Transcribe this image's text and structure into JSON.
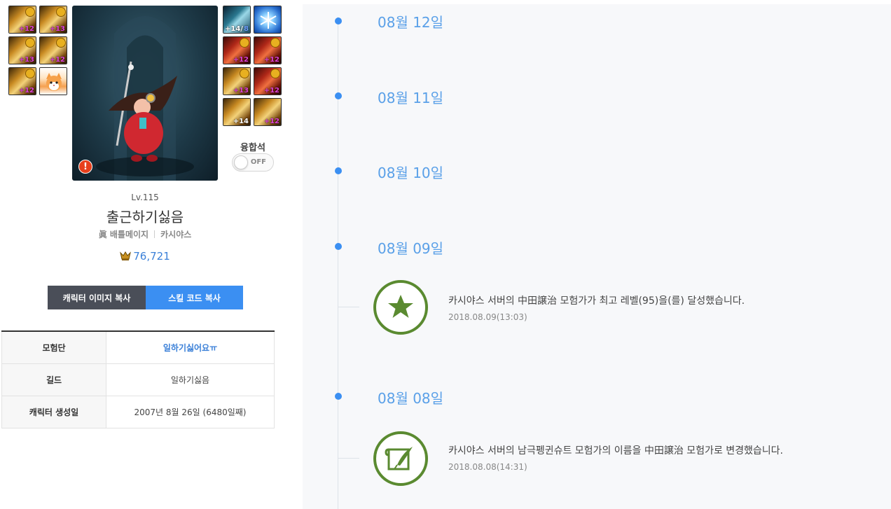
{
  "character": {
    "level": "Lv.115",
    "name": "출근하기싫음",
    "job": "眞 배틀메이지",
    "server": "카시야스",
    "combat_power": "76,721"
  },
  "equipment": {
    "left_slots": [
      {
        "plus": "+12",
        "color": "gold"
      },
      {
        "plus": "+13",
        "color": "gold"
      },
      {
        "plus": "+13",
        "color": "gold"
      },
      {
        "plus": "+12",
        "color": "gold"
      },
      {
        "plus": "+12",
        "color": "gold"
      },
      {
        "plus": "",
        "color": "pet"
      }
    ],
    "right_slots": [
      {
        "plus": "+14/",
        "plus2": "8",
        "color": "teal"
      },
      {
        "plus": "",
        "color": "ice"
      },
      {
        "plus": "+12",
        "color": "red"
      },
      {
        "plus": "+12",
        "color": "red"
      },
      {
        "plus": "+13",
        "color": "gold"
      },
      {
        "plus": "+12",
        "color": "red"
      },
      {
        "plus": "+14",
        "color": "gold"
      },
      {
        "plus": "+12",
        "color": "gold"
      }
    ]
  },
  "fusion": {
    "label": "융합석",
    "state": "OFF"
  },
  "warning_icon": "!",
  "buttons": {
    "copy_image": "캐릭터 이미지 복사",
    "copy_skill": "스킬 코드 복사"
  },
  "info_table": [
    {
      "key": "모험단",
      "value": "일하기싫어요ㅠ",
      "link": true
    },
    {
      "key": "길드",
      "value": "일하기싫음",
      "link": false
    },
    {
      "key": "캐릭터 생성일",
      "value": "2007년 8월 26일 (6480일째)",
      "link": false
    }
  ],
  "timeline": [
    {
      "date": "08월 12일"
    },
    {
      "date": "08월 11일"
    },
    {
      "date": "08월 10일"
    },
    {
      "date": "08월 09일",
      "event": {
        "icon": "star-icon",
        "text": "카시야스 서버의 中田譲治 모험가가 최고 레벨(95)을(를) 달성했습니다.",
        "time": "2018.08.09(13:03)"
      }
    },
    {
      "date": "08월 08일",
      "event": {
        "icon": "quill-icon",
        "text": "카시야스 서버의 남극펭귄슈트 모험가의 이름을 中田譲治 모험가로 변경했습니다.",
        "time": "2018.08.08(14:31)"
      }
    }
  ],
  "colors": {
    "accent": "#3b8ff2",
    "date_text": "#5aa0e8",
    "event_green": "#5a8a30",
    "dark_button": "#4a4e58",
    "warning": "#e8401c"
  }
}
